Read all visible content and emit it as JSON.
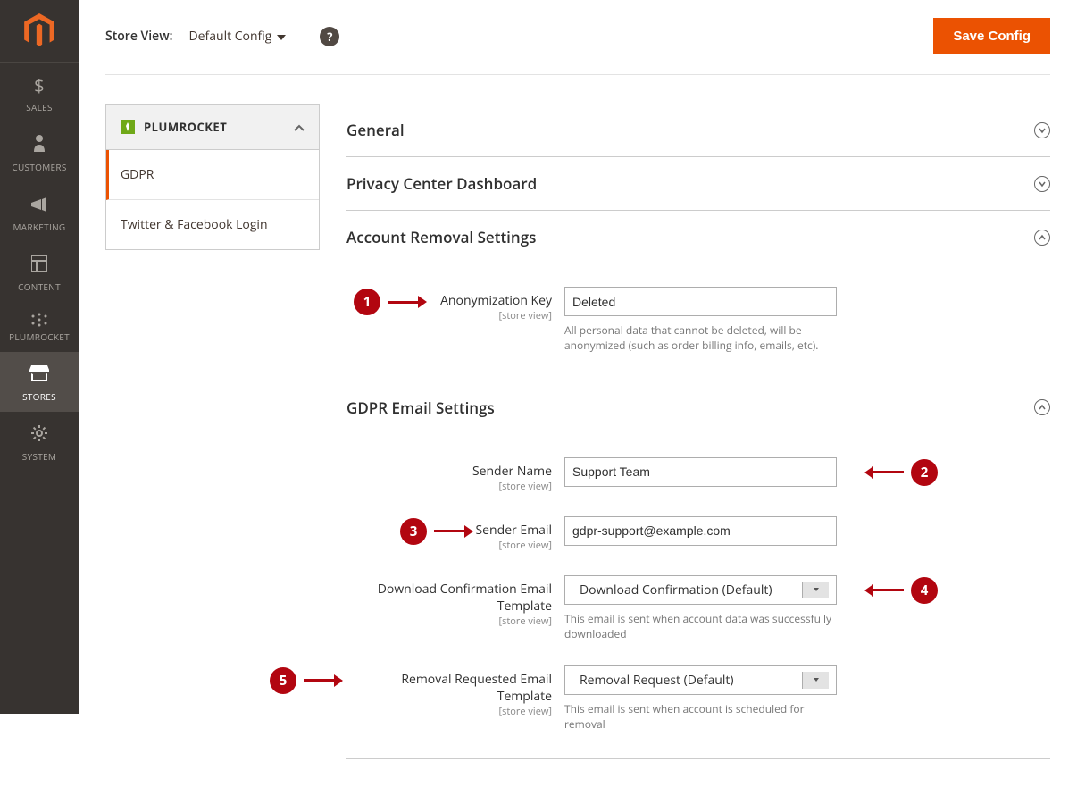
{
  "colors": {
    "accent": "#eb5202",
    "callout": "#b20610",
    "navbg": "#373330"
  },
  "nav": {
    "items": [
      {
        "label": "SALES"
      },
      {
        "label": "CUSTOMERS"
      },
      {
        "label": "MARKETING"
      },
      {
        "label": "CONTENT"
      },
      {
        "label": "PLUMROCKET"
      },
      {
        "label": "STORES"
      },
      {
        "label": "SYSTEM"
      }
    ]
  },
  "header": {
    "storeViewLabel": "Store View:",
    "storeViewValue": "Default Config",
    "saveLabel": "Save Config"
  },
  "sidebar": {
    "heading": "PLUMROCKET",
    "items": [
      {
        "label": "GDPR",
        "active": true
      },
      {
        "label": "Twitter & Facebook Login",
        "active": false
      }
    ]
  },
  "config": {
    "scopeLabel": "[store view]",
    "sections": {
      "general": {
        "title": "General"
      },
      "dashboard": {
        "title": "Privacy Center Dashboard"
      },
      "removal": {
        "title": "Account Removal Settings",
        "anonKey": {
          "label": "Anonymization Key",
          "value": "Deleted",
          "hint": "All personal data that cannot be deleted, will be anonymized (such as order billing info, emails, etc).",
          "callout": "1"
        }
      },
      "email": {
        "title": "GDPR Email Settings",
        "senderName": {
          "label": "Sender Name",
          "value": "Support Team",
          "callout": "2"
        },
        "senderEmail": {
          "label": "Sender Email",
          "value": "gdpr-support@example.com",
          "callout": "3"
        },
        "downloadTpl": {
          "label": "Download Confirmation Email Template",
          "value": "Download Confirmation (Default)",
          "hint": "This email is sent when account data was successfully downloaded",
          "callout": "4"
        },
        "removalTpl": {
          "label": "Removal Requested Email Template",
          "value": "Removal Request (Default)",
          "hint": "This email is sent when account is scheduled for removal",
          "callout": "5"
        }
      }
    }
  }
}
